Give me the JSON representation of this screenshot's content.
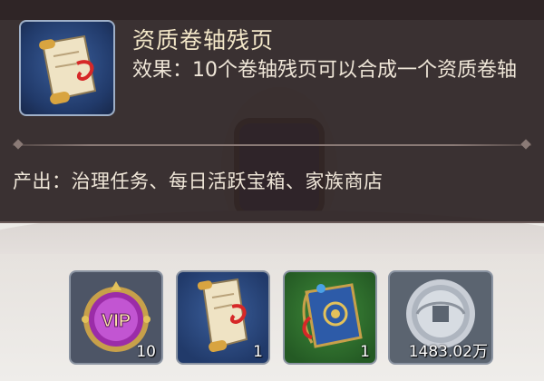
{
  "tooltip": {
    "item_icon": "scroll-fragment-icon",
    "title": "资质卷轴残页",
    "description": "效果：10个卷轴残页可以合成一个资质卷轴",
    "source": "产出：治理任务、每日活跃宝箱、家族商店"
  },
  "inventory": [
    {
      "icon": "vip-badge-icon",
      "label": "VIP",
      "count": "10"
    },
    {
      "icon": "scroll-fragment-icon",
      "count": "1"
    },
    {
      "icon": "blue-book-icon",
      "count": "1"
    },
    {
      "icon": "silver-coin-icon",
      "count": "1483.02万"
    }
  ],
  "colors": {
    "panel": "#2c2224",
    "title_text": "#f3e7c8",
    "body_text": "#efe6d8",
    "frame_blue": "#213a6a",
    "frame_green": "#245a24",
    "vip_purple": "#9b2ca8"
  }
}
